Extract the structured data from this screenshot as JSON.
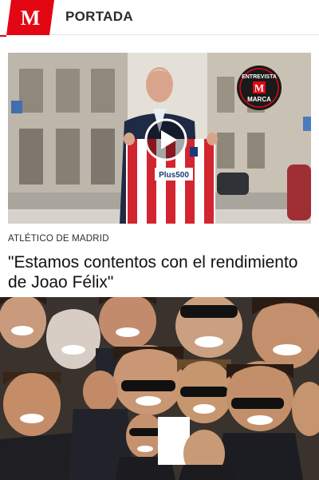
{
  "header": {
    "logo_letter": "M",
    "section_title": "PORTADA"
  },
  "hero": {
    "badge_top": "ENTREVISTA",
    "badge_letter": "M",
    "badge_bottom": "MARCA",
    "shirt_sponsor": "Plus500",
    "play_icon": "play-icon"
  },
  "article": {
    "category": "ATLÉTICO DE MADRID",
    "headline": "\"Estamos contentos con el rendimiento de Joao Félix\""
  },
  "colors": {
    "brand_red": "#e30613",
    "text_dark": "#111111"
  }
}
